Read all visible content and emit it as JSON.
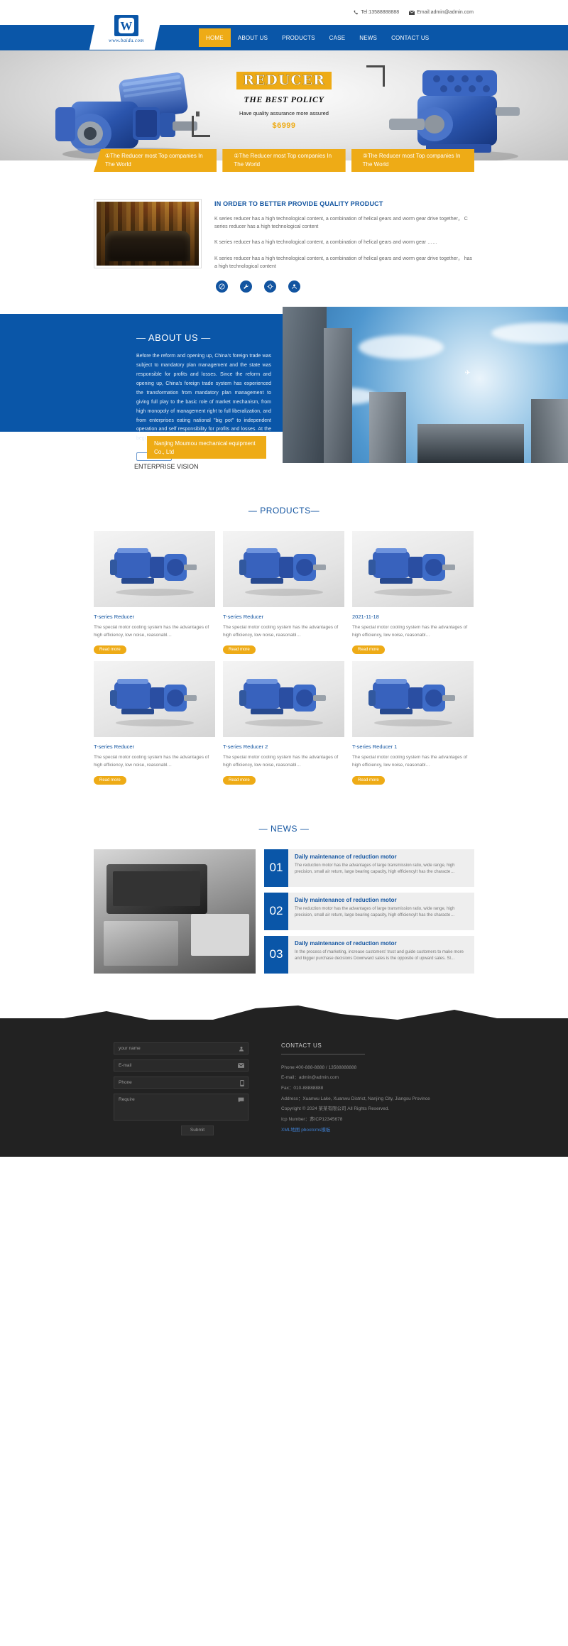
{
  "topbar": {
    "phone": "Tel:13588888888",
    "email": "Email:admin@admin.com",
    "phone_icon": "phone-icon",
    "email_icon": "mail-icon"
  },
  "logo": {
    "mark": "W",
    "url": "www.baidu.com"
  },
  "nav": {
    "items": [
      {
        "label": "HOME",
        "active": true
      },
      {
        "label": "ABOUT US",
        "active": false
      },
      {
        "label": "PRODUCTS",
        "active": false
      },
      {
        "label": "CASE",
        "active": false
      },
      {
        "label": "NEWS",
        "active": false
      },
      {
        "label": "CONTACT US",
        "active": false
      }
    ]
  },
  "hero": {
    "badge": "REDUCER",
    "policy": "THE  BEST  POLICY",
    "assurance": "Have quality assurance more assured",
    "price": "$6999",
    "bars": [
      "①The Reducer most Top companies In The World",
      "②The Reducer most Top companies In The World",
      "③The Reducer most Top companies In The World"
    ]
  },
  "quality": {
    "title": "IN ORDER TO BETTER PROVIDE QUALITY PRODUCT",
    "paragraphs": [
      "K series reducer has a high technological content, a combination of helical gears and worm gear drive together， C series reducer has a high technological content",
      "K series reducer has a high technological content, a combination of helical gears and worm gear ……",
      "K series reducer has a high technological content, a combination of helical gears and worm gear drive together， has a high technological content"
    ],
    "icons": [
      "no-entry-icon",
      "wrench-icon",
      "gear-icon",
      "person-icon"
    ]
  },
  "about": {
    "title": "— ABOUT US —",
    "body": "Before the reform and opening up, China's foreign trade was subject to mandatory plan management and the state was responsible for profits and losses. Since the reform and opening up, China's foreign trade system has experienced the transformation from mandatory plan management to giving full play to the basic role of market mechanism, from high monopoly of management right to full liberalization, and from enterprises eating national \"big pot\" to independent operation and self responsibility for profits and losses. At the begi...",
    "more_label": "more",
    "company_card": "Nanjing Moumou mechanical equipment Co., Ltd",
    "vision_label": "ENTERPRISE VISION"
  },
  "products": {
    "title": "— PRODUCTS—",
    "read_more": "Read more",
    "items": [
      {
        "name": "T-series Reducer",
        "desc": "The special motor cooling system has the advantages of high efficiency, low noise, reasonabl…"
      },
      {
        "name": "T-series Reducer",
        "desc": "The special motor cooling system has the advantages of high efficiency, low noise, reasonabl…"
      },
      {
        "name": "2021-11-18",
        "desc": "The special motor cooling system has the advantages of high efficiency, low noise, reasonabl…"
      },
      {
        "name": "T-series Reducer",
        "desc": "The special motor cooling system has the advantages of high efficiency, low noise, reasonabl…"
      },
      {
        "name": "T-series Reducer 2",
        "desc": "The special motor cooling system has the advantages of high efficiency, low noise, reasonabl…"
      },
      {
        "name": "T-series Reducer 1",
        "desc": "The special motor cooling system has the advantages of high efficiency, low noise, reasonabl…"
      }
    ]
  },
  "news": {
    "title": "— NEWS —",
    "items": [
      {
        "num": "01",
        "title": "Daily maintenance of reduction motor",
        "desc": "The reduction motor has the advantages of large transmission ratio, wide range, high precision, small air return, large bearing capacity, high efficiencyIt has the characte…"
      },
      {
        "num": "02",
        "title": "Daily maintenance of reduction motor",
        "desc": "The reduction motor has the advantages of large transmission ratio, wide range, high precision, small air return, large bearing capacity, high efficiencyIt has the characte…"
      },
      {
        "num": "03",
        "title": "Daily maintenance of reduction motor",
        "desc": "In the process of marketing, increase customers' trust and guide customers to make more and bigger purchase decisions Downward sales is the opposite of upward sales. Sl…"
      }
    ]
  },
  "footer": {
    "form": {
      "name_placeholder": "your name",
      "email_placeholder": "E-mail",
      "phone_placeholder": "Phone",
      "require_placeholder": "Require",
      "submit_label": "Submit",
      "name_icon": "person-icon",
      "email_icon": "mail-icon",
      "phone_icon": "mobile-icon",
      "require_icon": "comment-icon"
    },
    "contact": {
      "title": "CONTACT US",
      "lines": [
        "Phone:400-888-8888 / 13588888888",
        "E-mail：admin@admin.com",
        "Fax：010-88888888",
        "Address：Xuanwu Lake, Xuanwu District, Nanjing City, Jiangsu Province",
        "Copyright © 2024 某某有限公司 All Rights Reserved.",
        "Icp Number：苏ICP12345678"
      ],
      "link1": "XML地图",
      "link2": "pbootcms模板"
    }
  },
  "colors": {
    "brand_blue": "#0a56a8",
    "accent_yellow": "#eeab16",
    "link_blue": "#1254a0",
    "footer_dark": "#222222"
  }
}
